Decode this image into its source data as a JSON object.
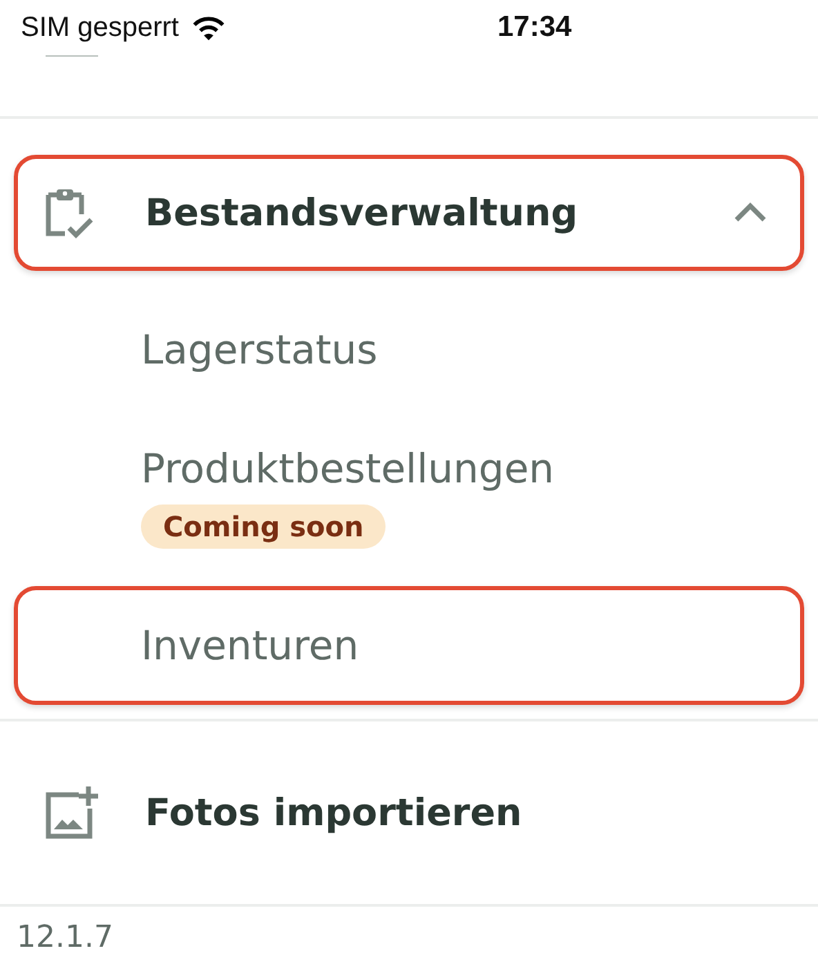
{
  "status_bar": {
    "carrier": "SIM gesperrt",
    "time": "17:34"
  },
  "menu": [
    {
      "kind": "group",
      "label": "Bestandsverwaltung",
      "expanded": true,
      "highlighted": true,
      "children": [
        {
          "label": "Lagerstatus",
          "highlighted": false
        },
        {
          "label": "Produktbestellungen",
          "badge": "Coming soon",
          "highlighted": false
        },
        {
          "label": "Inventuren",
          "highlighted": true
        }
      ]
    },
    {
      "kind": "item",
      "label": "Fotos importieren",
      "highlighted": false
    }
  ],
  "version": "12.1.7"
}
